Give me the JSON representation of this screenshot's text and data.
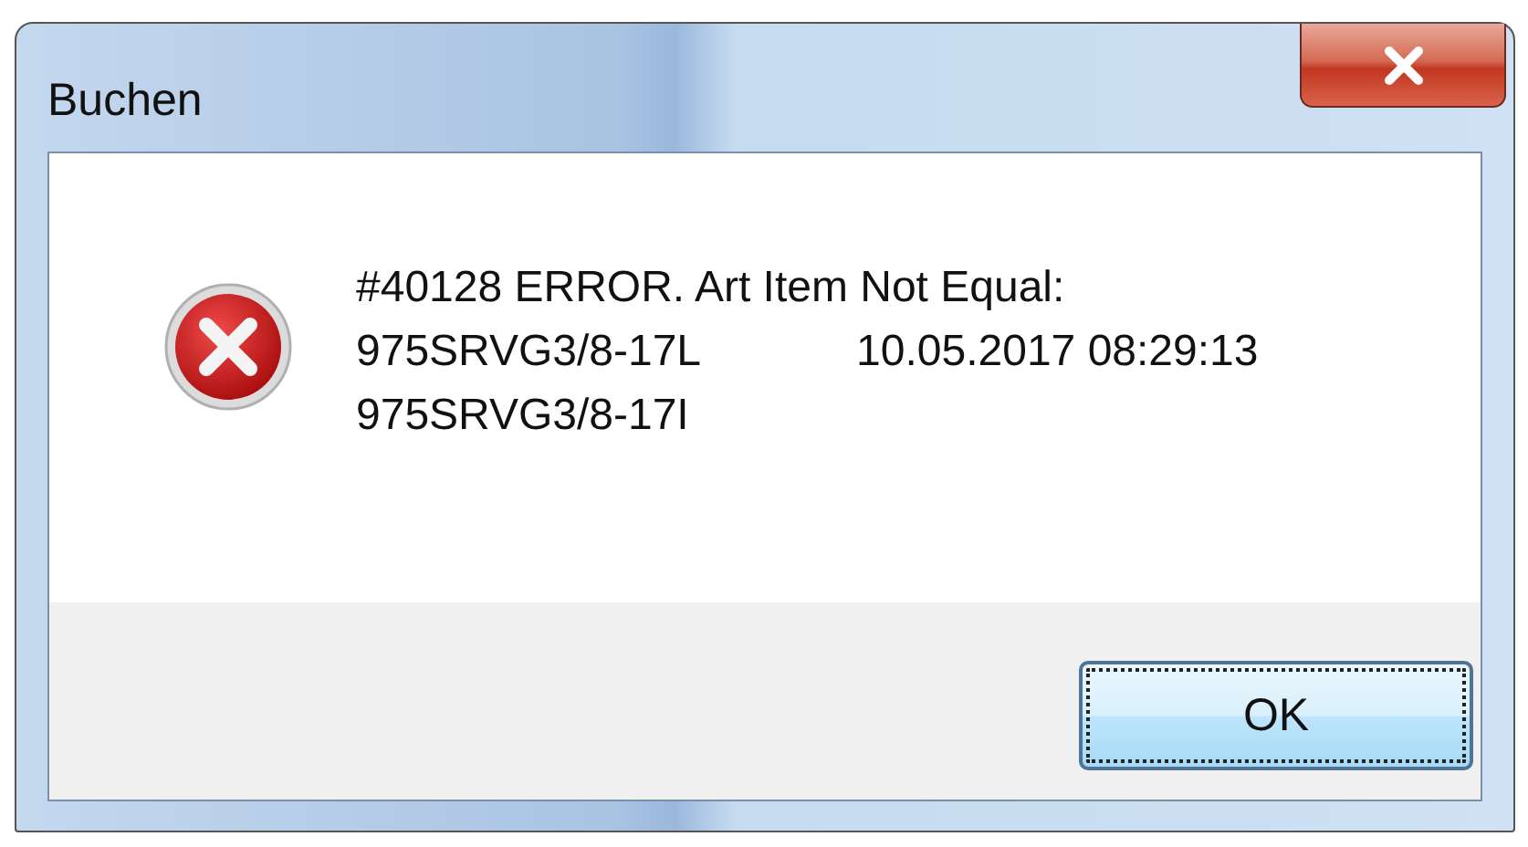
{
  "window": {
    "title": "Buchen"
  },
  "message": {
    "lines": [
      {
        "parts": [
          "#40128 ERROR. Art Item Not Equal:"
        ]
      },
      {
        "parts": [
          "975SRVG3/8-17L",
          "10.05.2017 08:29:13"
        ]
      },
      {
        "parts": [
          "975SRVG3/8-17I"
        ]
      }
    ]
  },
  "buttons": [
    {
      "label": "OK",
      "focused": true
    }
  ]
}
